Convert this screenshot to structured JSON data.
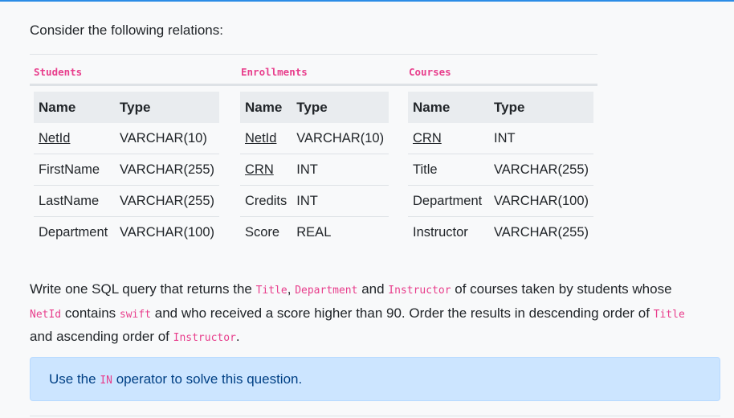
{
  "intro": "Consider the following relations:",
  "tables": {
    "students": {
      "caption": "Students",
      "headers": [
        "Name",
        "Type"
      ],
      "rows": [
        [
          "NetId",
          "VARCHAR(10)"
        ],
        [
          "FirstName",
          "VARCHAR(255)"
        ],
        [
          "LastName",
          "VARCHAR(255)"
        ],
        [
          "Department",
          "VARCHAR(100)"
        ]
      ]
    },
    "enrollments": {
      "caption": "Enrollments",
      "headers": [
        "Name",
        "Type"
      ],
      "rows": [
        [
          "NetId",
          "VARCHAR(10)"
        ],
        [
          "CRN",
          "INT"
        ],
        [
          "Credits",
          "INT"
        ],
        [
          "Score",
          "REAL"
        ]
      ]
    },
    "courses": {
      "caption": "Courses",
      "headers": [
        "Name",
        "Type"
      ],
      "rows": [
        [
          "CRN",
          "INT"
        ],
        [
          "Title",
          "VARCHAR(255)"
        ],
        [
          "Department",
          "VARCHAR(100)"
        ],
        [
          "Instructor",
          "VARCHAR(255)"
        ]
      ]
    }
  },
  "question": {
    "p1": "Write one SQL query that returns the ",
    "c1": "Title",
    "p2": ", ",
    "c2": "Department",
    "p3": " and ",
    "c3": "Instructor",
    "p4": " of courses taken by students whose ",
    "c4": "NetId",
    "p5": " contains ",
    "c5": "swift",
    "p6": " and who received a score higher than 90. Order the results in descending order of ",
    "c6": "Title",
    "p7": " and ascending order of ",
    "c7": "Instructor",
    "p8": "."
  },
  "hint": {
    "p1": "Use the ",
    "code": "IN",
    "p2": " operator to solve this question."
  }
}
